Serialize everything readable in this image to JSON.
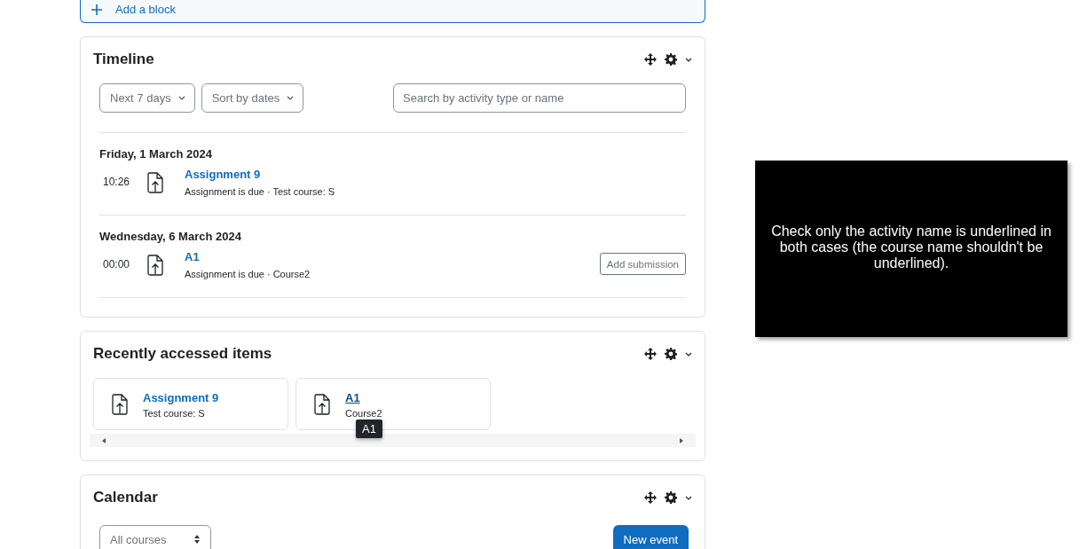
{
  "add_block": {
    "label": "Add a block"
  },
  "timeline": {
    "title": "Timeline",
    "filters": [
      {
        "label": "Next 7 days"
      },
      {
        "label": "Sort by dates"
      }
    ],
    "search": {
      "placeholder": "Search by activity type or name"
    },
    "groups": [
      {
        "date": "Friday, 1 March 2024",
        "events": [
          {
            "time": "10:26",
            "name": "Assignment 9",
            "details": "Assignment is due · Test course: S"
          }
        ]
      },
      {
        "date": "Wednesday, 6 March 2024",
        "events": [
          {
            "time": "00:00",
            "name": "A1",
            "details": "Assignment is due · Course2",
            "action": "Add submission"
          }
        ]
      }
    ]
  },
  "recent": {
    "title": "Recently accessed items",
    "items": [
      {
        "name": "Assignment 9",
        "course": "Test course: S",
        "hovered": false
      },
      {
        "name": "A1",
        "course": "Course2",
        "hovered": true,
        "tooltip": "A1"
      }
    ]
  },
  "calendar": {
    "title": "Calendar",
    "course_select": "All courses",
    "new_event": "New event"
  },
  "note": {
    "text": "Check only the activity name is underlined in both cases (the course name shouldn't be underlined)."
  }
}
